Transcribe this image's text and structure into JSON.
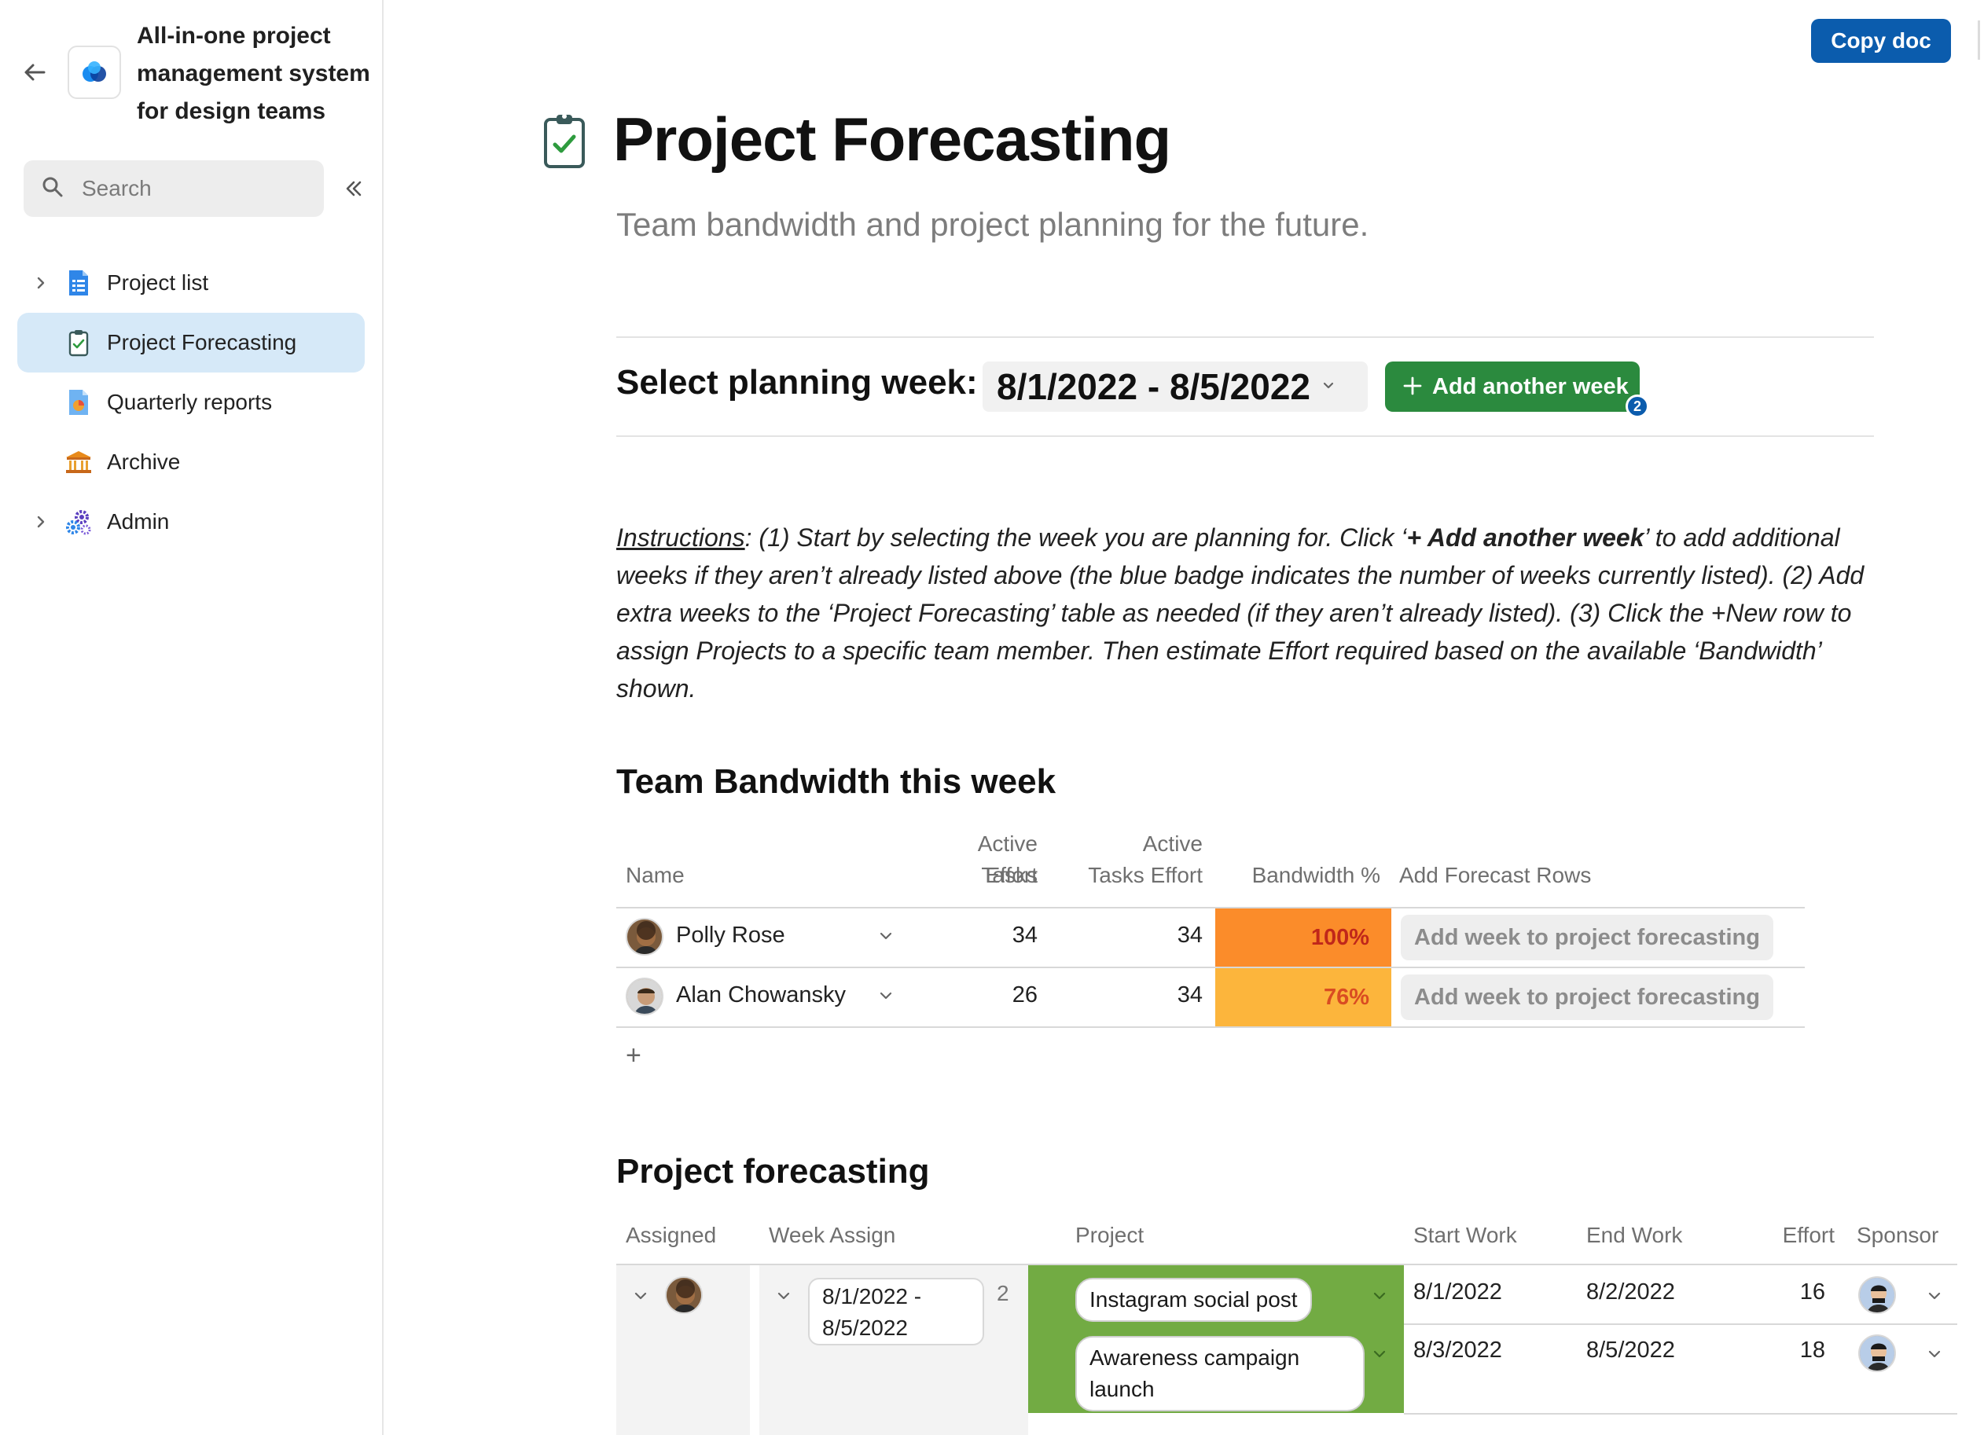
{
  "sidebar": {
    "doc_title": "All-in-one project management system for design teams",
    "search_placeholder": "Search",
    "items": [
      {
        "label": "Project list",
        "icon": "list-doc-icon",
        "has_chevron": true,
        "active": false
      },
      {
        "label": "Project Forecasting",
        "icon": "clipboard-check-icon",
        "has_chevron": false,
        "active": true
      },
      {
        "label": "Quarterly reports",
        "icon": "chart-doc-icon",
        "has_chevron": false,
        "active": false
      },
      {
        "label": "Archive",
        "icon": "bank-icon",
        "has_chevron": false,
        "active": false
      },
      {
        "label": "Admin",
        "icon": "gears-icon",
        "has_chevron": true,
        "active": false
      }
    ]
  },
  "header": {
    "copy_doc_label": "Copy doc"
  },
  "page": {
    "title": "Project Forecasting",
    "subtitle": "Team bandwidth and project planning for the future."
  },
  "planning": {
    "label": "Select planning week:",
    "selected_week": "8/1/2022 - 8/5/2022",
    "add_week_label": "Add another week",
    "weeks_badge": "2"
  },
  "instructions": {
    "lead": "Instructions",
    "part1": ": (1) Start by selecting the week you are planning for. Click ‘",
    "bold": "+ Add another week",
    "part2": "’ to add additional weeks if they aren’t already listed above (the blue badge indicates the number of weeks currently listed). (2) Add extra weeks to the ‘Project Forecasting’ table as needed (if they aren’t already listed). (3) Click the +New row to assign Projects to a specific team member. Then estimate Effort required based on the available ‘Bandwidth’ shown."
  },
  "team_bandwidth": {
    "heading": "Team Bandwidth this week",
    "columns": {
      "name": "Name",
      "active_tasks_effort_1": "Active Tasks",
      "active_tasks_effort_2": "Effort",
      "active_tasks_effort_b1": "Active",
      "active_tasks_effort_b2": "Tasks Effort",
      "bandwidth": "Bandwidth %",
      "add_forecast": "Add Forecast Rows"
    },
    "rows": [
      {
        "name": "Polly Rose",
        "effort_a": "34",
        "effort_b": "34",
        "bandwidth": "100%",
        "bandwidth_color": "#fb8c2a",
        "bandwidth_text_color": "#c0271a",
        "button": "Add week to project forecasting"
      },
      {
        "name": "Alan Chowansky",
        "effort_a": "26",
        "effort_b": "34",
        "bandwidth": "76%",
        "bandwidth_color": "#fcb53c",
        "bandwidth_text_color": "#d94c22",
        "button": "Add week to project forecasting"
      }
    ],
    "add_row_symbol": "+"
  },
  "project_forecasting": {
    "heading": "Project forecasting",
    "columns": {
      "assigned": "Assigned",
      "week_assign": "Week Assign",
      "project": "Project",
      "start_work": "Start Work",
      "end_work": "End Work",
      "effort": "Effort",
      "sponsor": "Sponsor"
    },
    "group": {
      "week_line1": "8/1/2022 -",
      "week_line2": "8/5/2022",
      "count": "2"
    },
    "rows": [
      {
        "project": "Instagram social post",
        "start": "8/1/2022",
        "end": "8/2/2022",
        "effort": "16"
      },
      {
        "project_line1": "Awareness campaign",
        "project_line2": "launch",
        "start": "8/3/2022",
        "end": "8/5/2022",
        "effort": "18"
      }
    ]
  },
  "colors": {
    "accent_blue": "#0b5cad",
    "add_week_green": "#2b8a3e",
    "project_green": "#72ab43",
    "active_nav": "#d6e9f8"
  }
}
